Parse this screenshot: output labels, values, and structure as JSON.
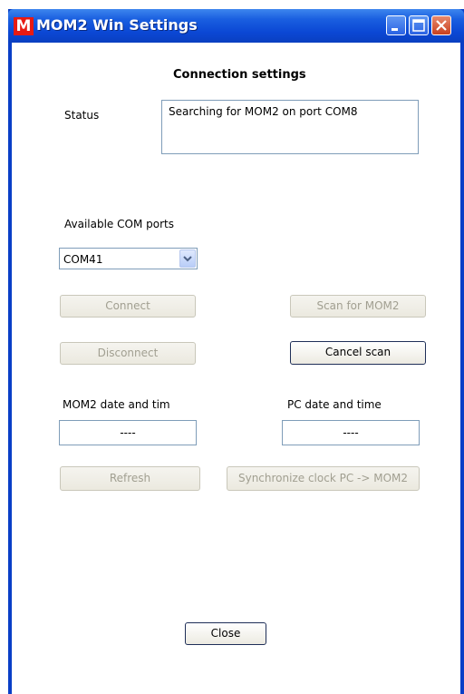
{
  "window": {
    "title": "MOM2 Win Settings",
    "app_icon_letter": "M"
  },
  "heading": "Connection settings",
  "status": {
    "label": "Status",
    "text": "Searching for MOM2 on port COM8"
  },
  "com_ports": {
    "label": "Available COM ports",
    "selected": "COM41"
  },
  "buttons": {
    "connect": "Connect",
    "scan": "Scan for MOM2",
    "disconnect": "Disconnect",
    "cancel_scan": "Cancel scan",
    "refresh": "Refresh",
    "sync": "Synchronize clock PC -> MOM2",
    "close": "Close"
  },
  "mom2_time": {
    "label": "MOM2 date and tim",
    "value": "----"
  },
  "pc_time": {
    "label": "PC date and time",
    "value": "----"
  }
}
